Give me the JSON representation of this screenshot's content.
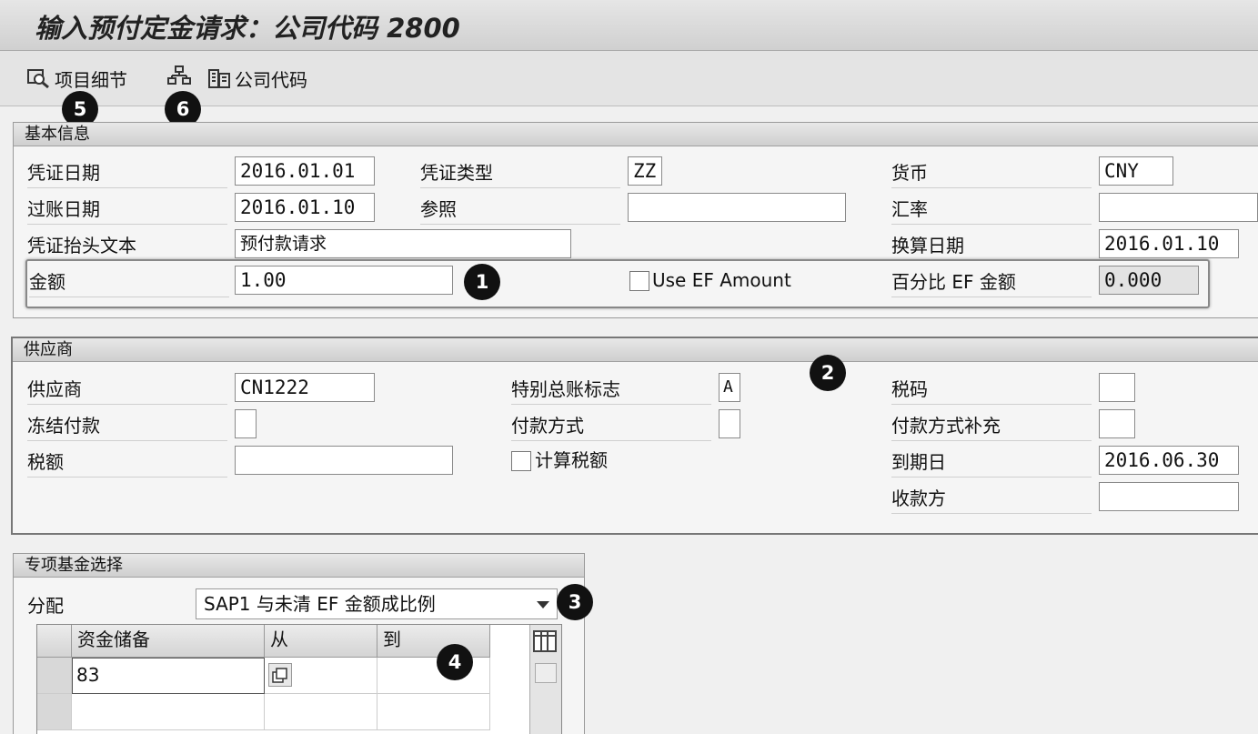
{
  "window": {
    "title": "输入预付定金请求：公司代码 2800"
  },
  "toolbar": {
    "item_detail_label": "项目细节",
    "company_code_label": "公司代码"
  },
  "markers": [
    "1",
    "2",
    "3",
    "4",
    "5",
    "6"
  ],
  "basic_info": {
    "section_title": "基本信息",
    "doc_date_label": "凭证日期",
    "doc_date_value": "2016.01.01",
    "doc_type_label": "凭证类型",
    "doc_type_value": "ZZ",
    "currency_label": "货币",
    "currency_value": "CNY",
    "posting_date_label": "过账日期",
    "posting_date_value": "2016.01.10",
    "reference_label": "参照",
    "reference_value": "",
    "exchange_rate_label": "汇率",
    "exchange_rate_value": "",
    "header_text_label": "凭证抬头文本",
    "header_text_value": "预付款请求",
    "translation_date_label": "换算日期",
    "translation_date_value": "2016.01.10",
    "amount_label": "金额",
    "amount_value": "1.00",
    "use_ef_amount_label": "Use EF Amount",
    "percent_ef_label": "百分比 EF 金额",
    "percent_ef_value": "0.000"
  },
  "vendor": {
    "section_title": "供应商",
    "vendor_label": "供应商",
    "vendor_value": "CN1222",
    "special_gl_label": "特别总账标志",
    "special_gl_value": "A",
    "tax_code_label": "税码",
    "tax_code_value": "",
    "payment_block_label": "冻结付款",
    "payment_block_value": "",
    "payment_method_label": "付款方式",
    "payment_method_value": "",
    "pmt_method_supp_label": "付款方式补充",
    "pmt_method_supp_value": "",
    "tax_amount_label": "税额",
    "tax_amount_value": "",
    "calc_tax_label": "计算税额",
    "due_date_label": "到期日",
    "due_date_value": "2016.06.30",
    "payee_label": "收款方",
    "payee_value": ""
  },
  "earmarked": {
    "section_title": "专项基金选择",
    "allocation_label": "分配",
    "allocation_value": "SAP1 与未清 EF 金额成比例",
    "columns": [
      "资金储备",
      "从",
      "到"
    ],
    "rows": [
      [
        "83",
        "",
        ""
      ],
      [
        "",
        "",
        ""
      ]
    ]
  }
}
